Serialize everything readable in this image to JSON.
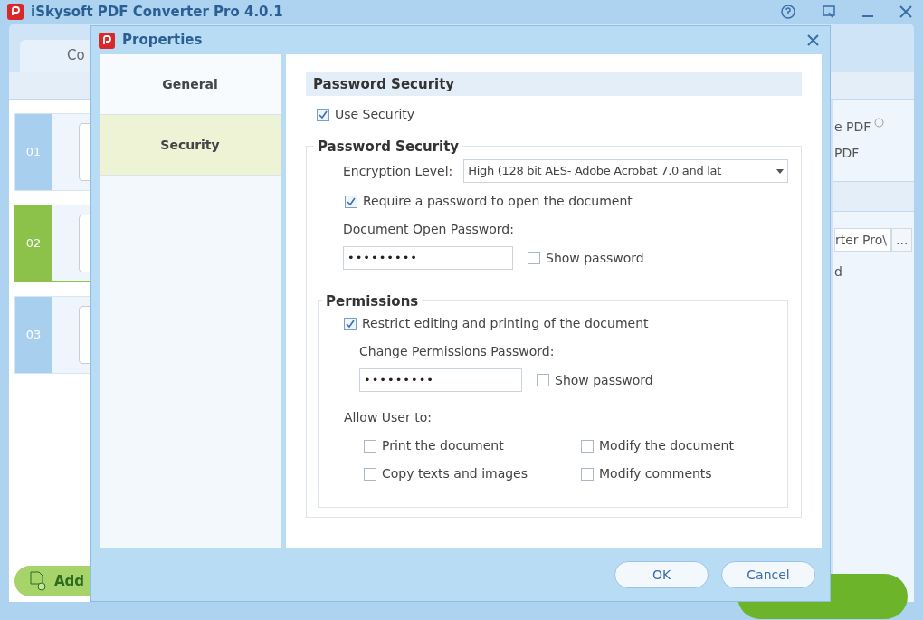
{
  "app": {
    "title": "iSkysoft PDF Converter Pro 4.0.1",
    "tab": "Co",
    "items": [
      {
        "number": "01",
        "selected": false
      },
      {
        "number": "02",
        "selected": true
      },
      {
        "number": "03",
        "selected": false
      }
    ],
    "add_button": "Add",
    "right_texts": [
      "e PDF",
      "PDF"
    ],
    "path_value": "rter Pro\\",
    "browse_button": "...",
    "path_note": "d"
  },
  "dialog": {
    "title": "Properties",
    "nav": [
      {
        "label": "General",
        "selected": false
      },
      {
        "label": "Security",
        "selected": true
      }
    ],
    "section_title": "Password Security",
    "use_security": {
      "label": "Use Security",
      "checked": true
    },
    "password_group": {
      "title": "Password Security",
      "encryption_label": "Encryption Level:",
      "encryption_value": "High (128 bit AES- Adobe Acrobat 7.0 and lat",
      "require_open": {
        "label": "Require a password to open the document",
        "checked": true
      },
      "open_password_label": "Document Open Password:",
      "open_password": "•••••••••",
      "show_password": {
        "label": "Show password",
        "checked": false
      }
    },
    "permissions": {
      "title": "Permissions",
      "restrict": {
        "label": "Restrict editing and printing of the document",
        "checked": true
      },
      "password_label": "Change Permissions Password:",
      "password": "•••••••••",
      "show_password": {
        "label": "Show password",
        "checked": false
      },
      "allow_label": "Allow User to:",
      "options": [
        {
          "label": "Print the document",
          "checked": false
        },
        {
          "label": "Modify the document",
          "checked": false
        },
        {
          "label": "Copy texts and images",
          "checked": false
        },
        {
          "label": "Modify comments",
          "checked": false
        }
      ]
    },
    "buttons": [
      "OK",
      "Cancel"
    ]
  }
}
